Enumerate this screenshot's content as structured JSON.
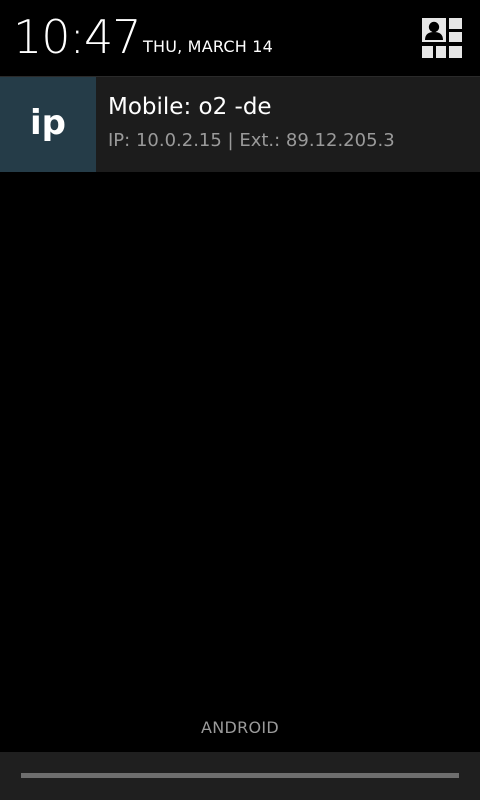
{
  "header": {
    "time": "10:47",
    "date": "THU, MARCH 14",
    "settings_icon": "quick-settings-icon"
  },
  "notification": {
    "icon_label": "ip",
    "icon_color": "#253c48",
    "title": "Mobile: o2 -de",
    "text": "IP: 10.0.2.15 | Ext.: 89.12.205.3"
  },
  "footer": {
    "carrier_label": "ANDROID"
  }
}
